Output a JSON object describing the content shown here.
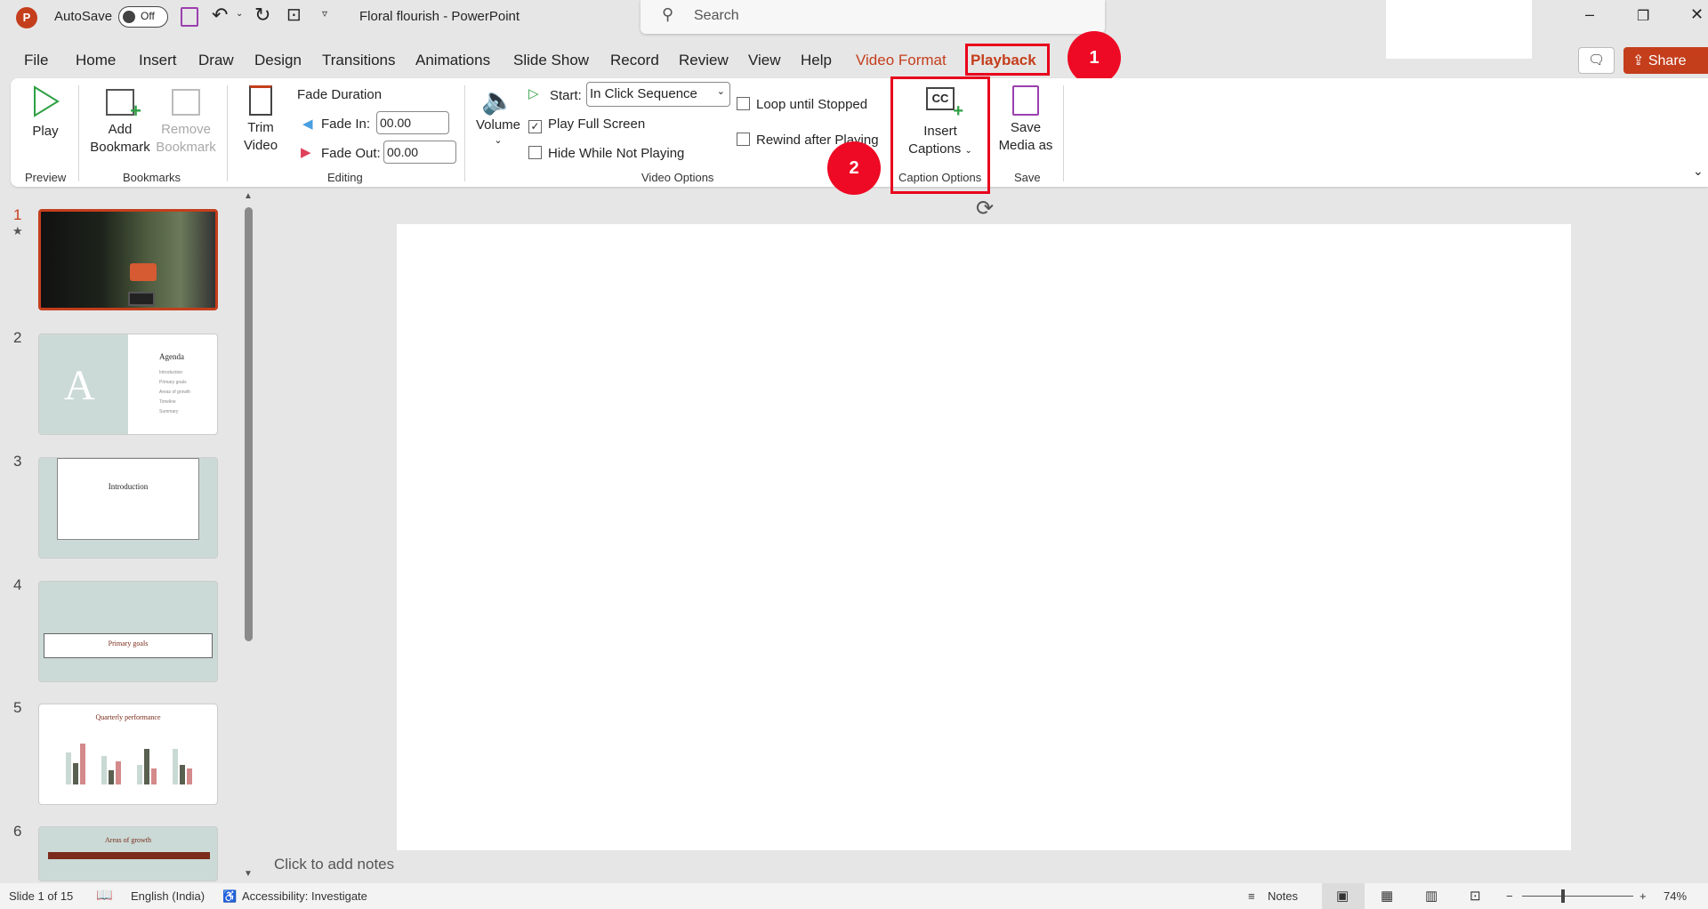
{
  "titlebar": {
    "autosave": "AutoSave",
    "toggle": "Off",
    "title": "Floral flourish  -  PowerPoint",
    "search_placeholder": "Search",
    "minimize": "–",
    "restore": "❐",
    "close": "✕"
  },
  "tabs": [
    "File",
    "Home",
    "Insert",
    "Draw",
    "Design",
    "Transitions",
    "Animations",
    "Slide Show",
    "Record",
    "Review",
    "View",
    "Help",
    "Video Format",
    "Playback"
  ],
  "share": "Share",
  "ribbon": {
    "play": "Play",
    "preview": "Preview",
    "add_bookmark": [
      "Add",
      "Bookmark"
    ],
    "remove_bookmark": [
      "Remove",
      "Bookmark"
    ],
    "bookmarks": "Bookmarks",
    "trim": [
      "Trim",
      "Video"
    ],
    "fade_duration": "Fade Duration",
    "fade_in": "Fade In:",
    "fade_in_value": "00.00",
    "fade_out": "Fade Out:",
    "fade_out_value": "00.00",
    "editing": "Editing",
    "volume": "Volume",
    "start": "Start:",
    "start_value": "In Click Sequence",
    "play_full_screen": "Play Full Screen",
    "play_full_screen_checked": true,
    "hide_while_not_playing": "Hide While Not Playing",
    "loop": "Loop until Stopped",
    "rewind": "Rewind after Playing",
    "video_options": "Video Options",
    "insert_captions": [
      "Insert",
      "Captions"
    ],
    "caption_options": "Caption Options",
    "save_media": [
      "Save",
      "Media as"
    ],
    "save": "Save"
  },
  "annotations": {
    "one": "1",
    "two": "2",
    "color": "#ee0a24"
  },
  "slides": [
    {
      "num": "1"
    },
    {
      "num": "2",
      "title": "Agenda",
      "items": [
        "Introduction",
        "Primary goals",
        "Areas of growth",
        "Timeline",
        "Summary"
      ]
    },
    {
      "num": "3",
      "title": "Introduction"
    },
    {
      "num": "4",
      "title": "Primary goals"
    },
    {
      "num": "5",
      "title": "Quarterly performance"
    },
    {
      "num": "6",
      "title": "Areas of growth"
    }
  ],
  "notes_placeholder": "Click to add notes",
  "status": {
    "slide": "Slide 1 of 15",
    "language": "English (India)",
    "accessibility": "Accessibility: Investigate",
    "notes": "Notes",
    "zoom": "74%"
  }
}
